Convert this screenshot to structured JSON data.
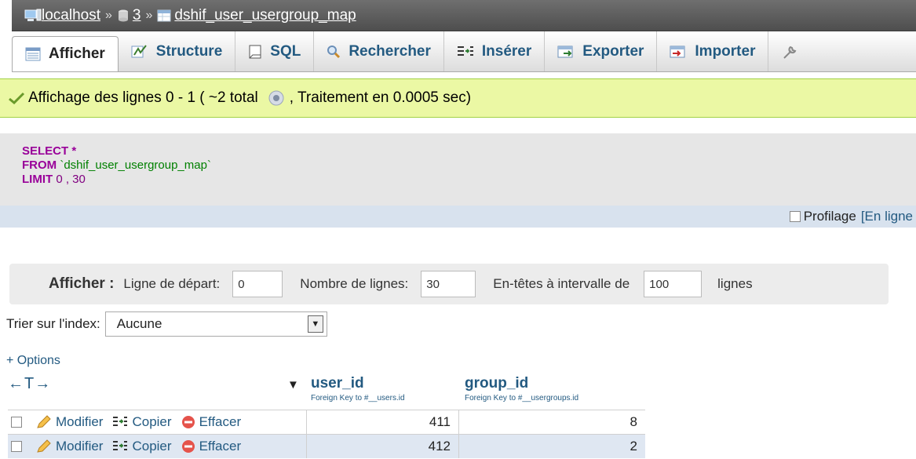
{
  "breadcrumb": {
    "server": "localhost",
    "separator": "»",
    "database": "3",
    "table": "dshif_user_usergroup_map"
  },
  "tabs": [
    {
      "label": "Afficher",
      "icon": "browse-icon"
    },
    {
      "label": "Structure",
      "icon": "structure-icon"
    },
    {
      "label": "SQL",
      "icon": "sql-icon"
    },
    {
      "label": "Rechercher",
      "icon": "search-icon"
    },
    {
      "label": "Insérer",
      "icon": "insert-icon"
    },
    {
      "label": "Exporter",
      "icon": "export-icon"
    },
    {
      "label": "Importer",
      "icon": "import-icon"
    }
  ],
  "notice": {
    "text_before": "Affichage des lignes 0 - 1 ( ~2 total",
    "text_after": ", Traitement en 0.0005 sec)"
  },
  "sql": {
    "select_kw": "SELECT",
    "star": "*",
    "from_kw": "FROM",
    "table": "`dshif_user_usergroup_map`",
    "limit_kw": "LIMIT",
    "limit_vals": "0 , 30"
  },
  "sqltools": {
    "profiling_label": "Profilage",
    "inline_link": "[En ligne"
  },
  "navform": {
    "title": "Afficher :",
    "start_label": "Ligne de départ:",
    "start_value": "0",
    "rows_label": "Nombre de lignes:",
    "rows_value": "30",
    "headers_label": "En-têtes à intervalle de",
    "headers_value": "100",
    "headers_suffix": "lignes"
  },
  "sort": {
    "label": "Trier sur l'index:",
    "value": "Aucune"
  },
  "options_link": "+ Options",
  "table": {
    "arrows": "←T→",
    "columns": [
      {
        "name": "user_id",
        "fk": "Foreign Key to #__users.id"
      },
      {
        "name": "group_id",
        "fk": "Foreign Key to #__usergroups.id"
      }
    ],
    "actions": {
      "edit": "Modifier",
      "copy": "Copier",
      "delete": "Effacer"
    },
    "rows": [
      {
        "user_id": "411",
        "group_id": "8"
      },
      {
        "user_id": "412",
        "group_id": "2"
      }
    ]
  },
  "colors": {
    "link": "#235a81",
    "notice_bg": "#ebf8a4",
    "keyword": "#990099",
    "string": "#008000"
  }
}
